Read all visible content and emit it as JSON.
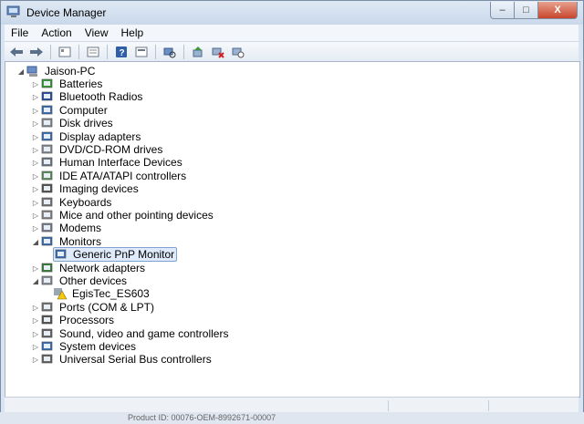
{
  "window": {
    "title": "Device Manager"
  },
  "title_buttons": {
    "min": "–",
    "max": "□",
    "close": "X"
  },
  "menu": [
    {
      "label": "File"
    },
    {
      "label": "Action"
    },
    {
      "label": "View"
    },
    {
      "label": "Help"
    }
  ],
  "toolbar": {
    "icons": [
      "back-arrow-icon",
      "forward-arrow-icon",
      "computer-view-icon",
      "properties-icon",
      "help-icon",
      "view-list-icon",
      "scan-hardware-icon",
      "update-driver-icon",
      "uninstall-icon",
      "disable-device-icon"
    ]
  },
  "tree": {
    "root": "Jaison-PC",
    "items": [
      {
        "label": "Batteries",
        "icon": "battery-icon",
        "color": "#3a9a3a",
        "expanded": false
      },
      {
        "label": "Bluetooth Radios",
        "icon": "bluetooth-icon",
        "color": "#2a4f9e",
        "expanded": false
      },
      {
        "label": "Computer",
        "icon": "computer-icon",
        "color": "#3d6fb5",
        "expanded": false
      },
      {
        "label": "Disk drives",
        "icon": "disk-drive-icon",
        "color": "#8a8f96",
        "expanded": false
      },
      {
        "label": "Display adapters",
        "icon": "display-adapter-icon",
        "color": "#3d6fb5",
        "expanded": false
      },
      {
        "label": "DVD/CD-ROM drives",
        "icon": "dvd-drive-icon",
        "color": "#8a8f96",
        "expanded": false
      },
      {
        "label": "Human Interface Devices",
        "icon": "hid-icon",
        "color": "#6f7a86",
        "expanded": false
      },
      {
        "label": "IDE ATA/ATAPI controllers",
        "icon": "ide-controller-icon",
        "color": "#5f8f5f",
        "expanded": false
      },
      {
        "label": "Imaging devices",
        "icon": "camera-icon",
        "color": "#555",
        "expanded": false
      },
      {
        "label": "Keyboards",
        "icon": "keyboard-icon",
        "color": "#777",
        "expanded": false
      },
      {
        "label": "Mice and other pointing devices",
        "icon": "mouse-icon",
        "color": "#888",
        "expanded": false
      },
      {
        "label": "Modems",
        "icon": "modem-icon",
        "color": "#7a8090",
        "expanded": false
      },
      {
        "label": "Monitors",
        "icon": "monitor-icon",
        "color": "#3d6fb5",
        "expanded": true
      },
      {
        "label": "Network adapters",
        "icon": "network-adapter-icon",
        "color": "#3a7f3a",
        "expanded": false
      },
      {
        "label": "Other devices",
        "icon": "other-devices-icon",
        "color": "#8a8f96",
        "expanded": true
      },
      {
        "label": "Ports (COM & LPT)",
        "icon": "port-icon",
        "color": "#777",
        "expanded": false
      },
      {
        "label": "Processors",
        "icon": "processor-icon",
        "color": "#555",
        "expanded": false
      },
      {
        "label": "Sound, video and game controllers",
        "icon": "speaker-icon",
        "color": "#666",
        "expanded": false
      },
      {
        "label": "System devices",
        "icon": "system-device-icon",
        "color": "#3d6fb5",
        "expanded": false
      },
      {
        "label": "Universal Serial Bus controllers",
        "icon": "usb-icon",
        "color": "#666",
        "expanded": false
      }
    ],
    "monitor_child": "Generic PnP Monitor",
    "other_child": "EgisTec_ES603"
  },
  "below_text": "Product ID: 00076-OEM-8992671-00007"
}
